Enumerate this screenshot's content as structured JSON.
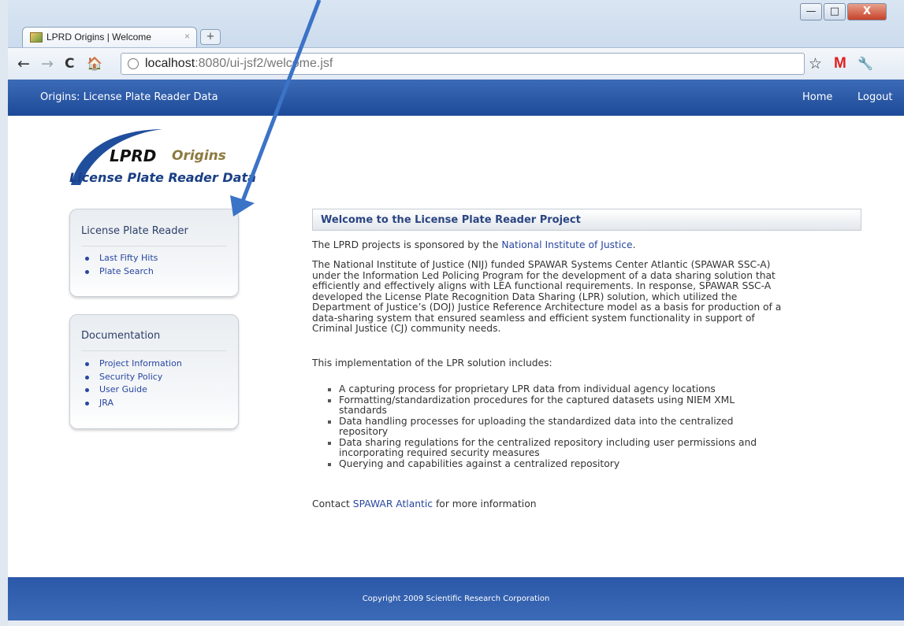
{
  "browser": {
    "tab_title": "LPRD Origins | Welcome",
    "tab_close": "×",
    "new_tab": "+",
    "window_controls": {
      "minimize": "—",
      "maximize": "□",
      "close": "X"
    },
    "nav": {
      "back": "←",
      "forward": "→",
      "reload": "C",
      "home": "🏠"
    },
    "url_host": "localhost",
    "url_rest": ":8080/ui-jsf2/welcome.jsf",
    "star": "☆",
    "gmail": "M",
    "wrench": "🔧"
  },
  "app": {
    "title": "Origins: License Plate Reader Data",
    "nav": {
      "home": "Home",
      "logout": "Logout"
    },
    "logo": {
      "lprd": "LPRD",
      "origins": "Origins",
      "subtitle": "License Plate Reader Data"
    }
  },
  "sidebar": {
    "plate_reader": {
      "heading": "License Plate Reader",
      "items": [
        {
          "label": "Last Fifty Hits"
        },
        {
          "label": "Plate Search"
        }
      ]
    },
    "documentation": {
      "heading": "Documentation",
      "items": [
        {
          "label": "Project Information"
        },
        {
          "label": "Security Policy"
        },
        {
          "label": "User Guide"
        },
        {
          "label": "JRA"
        }
      ]
    }
  },
  "main": {
    "heading": "Welcome to the License Plate Reader Project",
    "p1_before": "The LPRD projects is sponsored by the ",
    "p1_link": "National Institute of Justice",
    "p1_after": ".",
    "p2_lines": [
      "The National Institute of Justice (NIJ) funded SPAWAR Systems Center Atlantic (SPAWAR SSC-A)",
      "under the Information Led Policing Program for the development of a data sharing solution that",
      "efficiently and effectively aligns with LEA functional requirements. In response, SPAWAR SSC-A",
      "developed the License Plate Recognition Data Sharing (LPR) solution, which utilized the",
      "Department of Justice’s (DOJ) Justice Reference Architecture model as a basis for production of a",
      "data-sharing system that ensured seamless and efficient system functionality in support of",
      "Criminal Justice (CJ) community needs."
    ],
    "p3": "This implementation of the LPR solution includes:",
    "bullets": [
      {
        "lines": [
          "A capturing process for proprietary LPR data from individual agency locations"
        ]
      },
      {
        "lines": [
          "Formatting/standardization procedures for the captured datasets using NIEM XML",
          "standards"
        ]
      },
      {
        "lines": [
          "Data handling processes for uploading the standardized data into the centralized",
          "repository"
        ]
      },
      {
        "lines": [
          "Data sharing regulations for the centralized repository including user permissions and",
          "incorporating required security measures"
        ]
      },
      {
        "lines": [
          "Querying and capabilities against a centralized repository"
        ]
      }
    ],
    "contact_before": "Contact ",
    "contact_link": "SPAWAR Atlantic",
    "contact_after": " for more information"
  },
  "footer": {
    "copyright": "Copyright 2009 Scientific Research Corporation"
  },
  "colors": {
    "header_blue": "#1d4a98",
    "link_blue": "#2846a0",
    "arrow_blue": "#3b73c7"
  }
}
